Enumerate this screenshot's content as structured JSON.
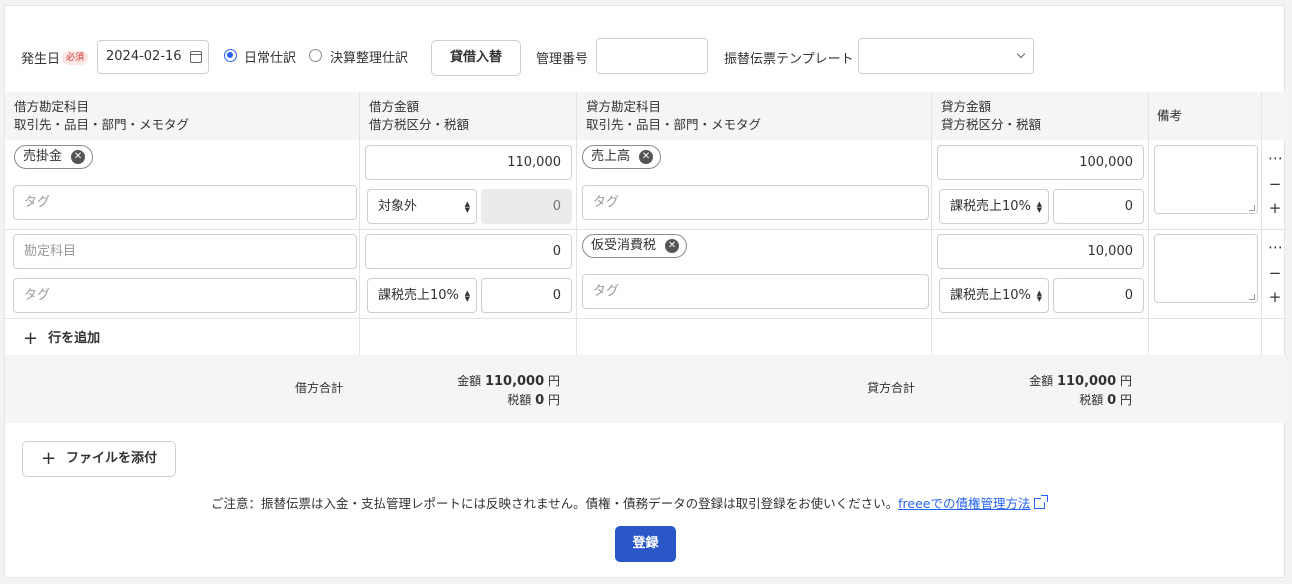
{
  "header": {
    "date_label": "発生日",
    "required_badge": "必須",
    "date_value": "2024-02-16",
    "radio_normal": "日常仕訳",
    "radio_closing": "決算整理仕訳",
    "swap_button": "貸借入替",
    "mgmt_label": "管理番号",
    "mgmt_value": "",
    "template_label": "振替伝票テンプレート",
    "template_value": ""
  },
  "table": {
    "headers": {
      "debit_account": "借方勘定科目",
      "debit_account_sub": "取引先・品目・部門・メモタグ",
      "debit_amount": "借方金額",
      "debit_amount_sub": "借方税区分・税額",
      "credit_account": "貸方勘定科目",
      "credit_account_sub": "取引先・品目・部門・メモタグ",
      "credit_amount": "貸方金額",
      "credit_amount_sub": "貸方税区分・税額",
      "remarks": "備考"
    },
    "rows": [
      {
        "debit_account": "売掛金",
        "debit_tag_placeholder": "タグ",
        "debit_amount": "110,000",
        "debit_tax_category": "対象外",
        "debit_tax": "0",
        "credit_account": "売上高",
        "credit_tag_placeholder": "タグ",
        "credit_amount": "100,000",
        "credit_tax_category": "課税売上10%",
        "credit_tax": "0"
      },
      {
        "debit_account_placeholder": "勘定科目",
        "debit_tag_placeholder": "タグ",
        "debit_amount": "0",
        "debit_tax_category": "課税売上10%",
        "debit_tax": "0",
        "credit_account": "仮受消費税",
        "credit_tag_placeholder": "タグ",
        "credit_amount": "10,000",
        "credit_tax_category": "課税売上10%",
        "credit_tax": "0"
      }
    ],
    "row_controls": {
      "more": "⋯",
      "remove": "−",
      "add": "+"
    },
    "add_row": "行を追加",
    "totals": {
      "debit_label": "借方合計",
      "credit_label": "貸方合計",
      "amount_label": "金額",
      "tax_label": "税額",
      "yen": "円",
      "debit_amount": "110,000",
      "debit_tax": "0",
      "credit_amount": "110,000",
      "credit_tax": "0"
    }
  },
  "footer": {
    "attach_button": "ファイルを添付",
    "notice": "ご注意：振替伝票は入金・支払管理レポートには反映されません。債権・債務データの登録は取引登録をお使いください。",
    "notice_link": "freeeでの債権管理方法",
    "register_button": "登録"
  },
  "colors": {
    "accent": "#2864f0",
    "primary_button": "#2a57c8",
    "required_badge_bg": "#fce6e6",
    "required_badge_text": "#d0342c"
  }
}
